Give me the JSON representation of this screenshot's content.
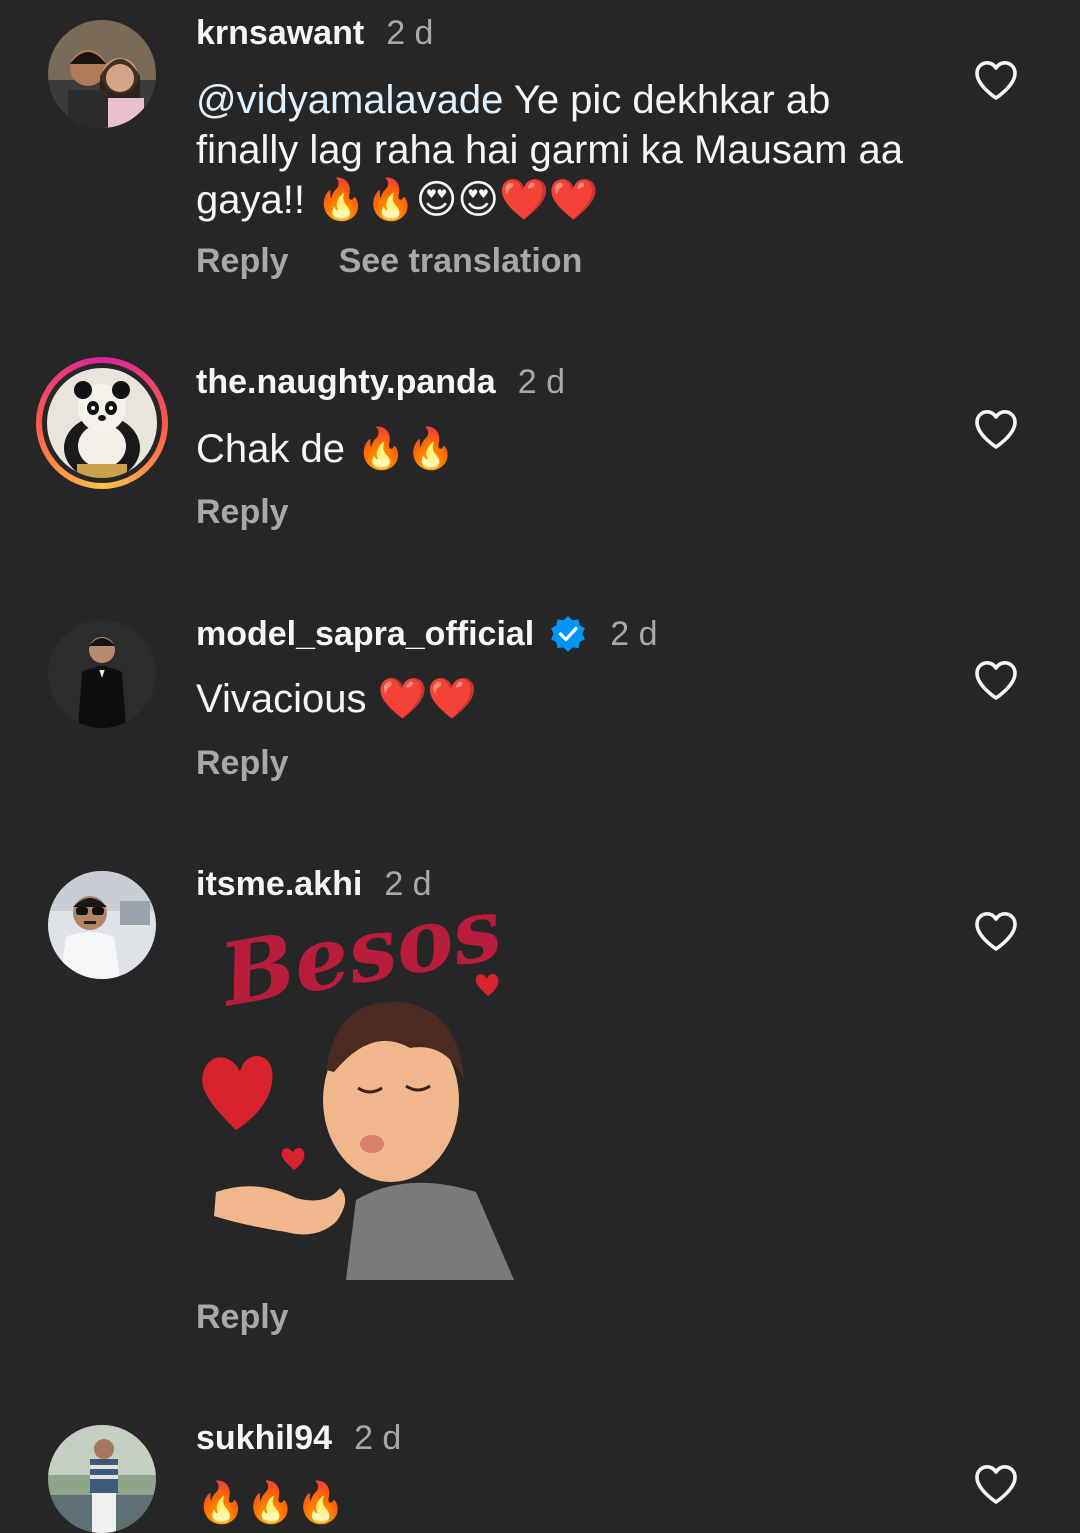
{
  "comments": [
    {
      "username": "krnsawant",
      "time": "2 d",
      "mention": "@vidyamalavade",
      "text": " Ye pic dekhkar ab finally lag raha hai garmi ka Mausam aa gaya!! ",
      "emojis": "🔥🔥😍😍❤️❤️",
      "reply": "Reply",
      "see_translation": "See translation"
    },
    {
      "username": "the.naughty.panda",
      "time": "2 d",
      "text": "Chak de ",
      "emojis": "🔥🔥",
      "reply": "Reply"
    },
    {
      "username": "model_sapra_official",
      "time": "2 d",
      "text": "Vivacious ",
      "emojis": "❤️❤️",
      "reply": "Reply"
    },
    {
      "username": "itsme.akhi",
      "time": "2 d",
      "sticker_text": "Besos",
      "reply": "Reply"
    },
    {
      "username": "sukhil94",
      "time": "2 d",
      "emojis": "🔥🔥🔥"
    }
  ],
  "colors": {
    "background": "#262626",
    "text": "#f5f5f5",
    "secondary": "#a8a8a8",
    "verified": "#0095f6"
  },
  "icons": {
    "like": "heart-outline-icon",
    "verified": "verified-badge-icon"
  }
}
